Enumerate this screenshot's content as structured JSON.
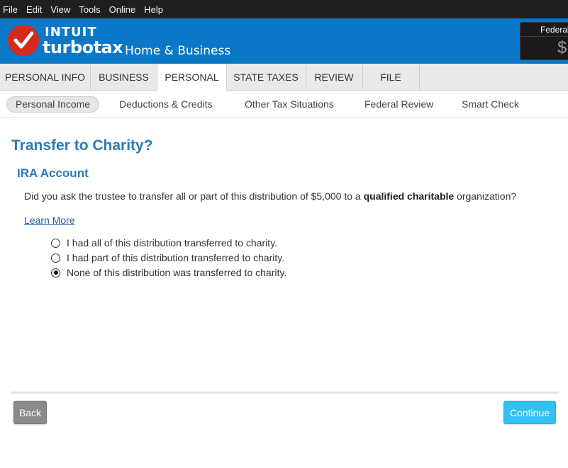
{
  "menu": [
    "File",
    "Edit",
    "View",
    "Tools",
    "Online",
    "Help"
  ],
  "brand": {
    "company": "INTUIT",
    "product": "turbotax",
    "edition": "Home & Business",
    "logo_icon": "checkmark-icon",
    "colors": {
      "header": "#0a78c7",
      "logo": "#d52b1e"
    }
  },
  "refund_meter": {
    "label": "Federal",
    "amount": "$"
  },
  "tabs": [
    {
      "label": "PERSONAL INFO",
      "active": false
    },
    {
      "label": "BUSINESS",
      "active": false
    },
    {
      "label": "PERSONAL",
      "active": true
    },
    {
      "label": "STATE TAXES",
      "active": false
    },
    {
      "label": "REVIEW",
      "active": false
    },
    {
      "label": "FILE",
      "active": false
    }
  ],
  "subtabs": [
    {
      "label": "Personal Income",
      "active": true
    },
    {
      "label": "Deductions & Credits",
      "active": false
    },
    {
      "label": "Other Tax Situations",
      "active": false
    },
    {
      "label": "Federal Review",
      "active": false
    },
    {
      "label": "Smart Check",
      "active": false
    }
  ],
  "page": {
    "title": "Transfer to Charity?",
    "section": "IRA Account",
    "question_before": "Did you ask the trustee to transfer all or part of this distribution of $5,000 to a ",
    "question_bold": "qualified charitable",
    "question_after": " organization?",
    "learn_more": "Learn More",
    "options": [
      {
        "label": "I had all of this distribution transferred to charity.",
        "checked": false
      },
      {
        "label": "I had part of this distribution transferred to charity.",
        "checked": false
      },
      {
        "label": "None of this distribution was transferred to charity.",
        "checked": true
      }
    ]
  },
  "footer": {
    "back": "Back",
    "continue": "Continue",
    "colors": {
      "continue": "#33c0f2",
      "back": "#8a8a8a"
    }
  }
}
